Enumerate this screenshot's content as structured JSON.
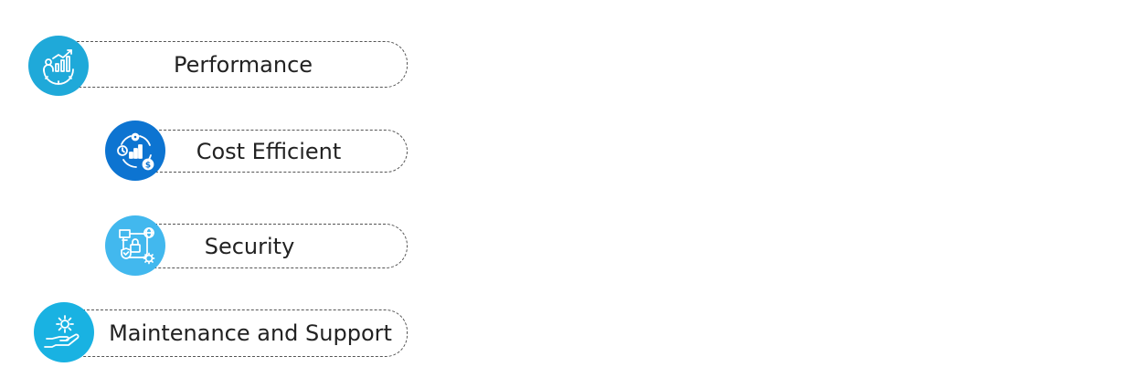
{
  "items": [
    {
      "label": "Performance",
      "icon": "performance-gear-chart-icon",
      "color": "#1fa9d9"
    },
    {
      "label": "Cost Efficient",
      "icon": "cost-chart-dollar-icon",
      "color": "#0d74d1"
    },
    {
      "label": "Security",
      "icon": "security-lock-shield-icon",
      "color": "#42b8ee"
    },
    {
      "label": "Maintenance and Support",
      "icon": "hand-gear-icon",
      "color": "#19b2e2"
    }
  ]
}
